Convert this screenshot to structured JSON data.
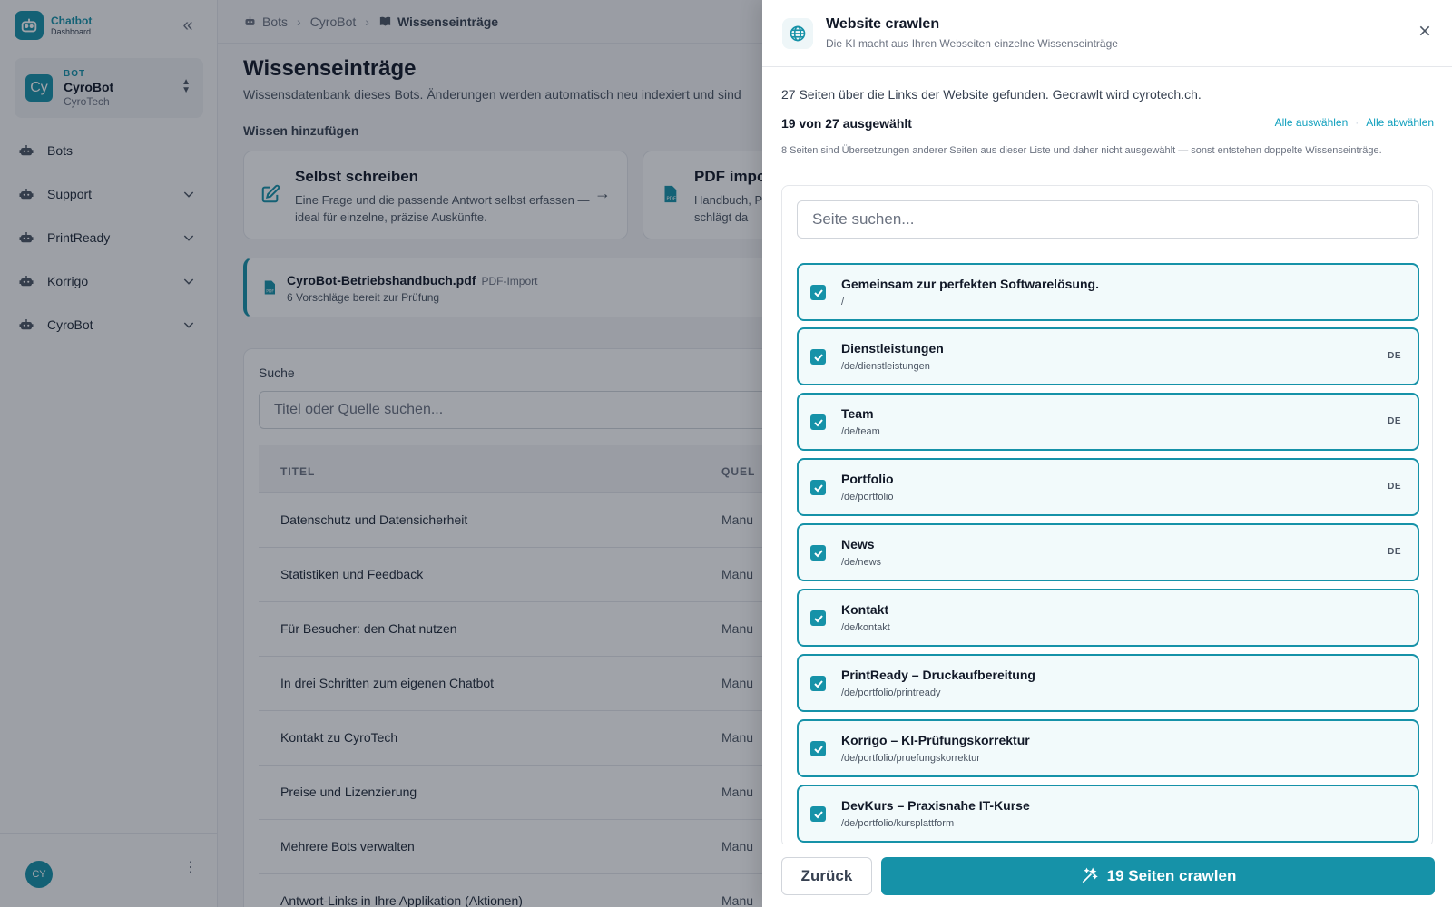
{
  "brand": {
    "name": "Chatbot",
    "sub": "Dashboard"
  },
  "bot_switcher": {
    "label": "BOT",
    "name": "CyroBot",
    "org": "CyroTech",
    "avatar": "Cy"
  },
  "sidebar": {
    "items": [
      {
        "label": "Bots",
        "icon": "robot-icon",
        "expandable": false
      },
      {
        "label": "Support",
        "icon": "robot-icon",
        "expandable": true
      },
      {
        "label": "PrintReady",
        "icon": "robot-icon",
        "expandable": true
      },
      {
        "label": "Korrigo",
        "icon": "robot-icon",
        "expandable": true
      },
      {
        "label": "CyroBot",
        "icon": "robot-icon",
        "expandable": true
      }
    ],
    "user_initials": "CY"
  },
  "breadcrumb": [
    "Bots",
    "CyroBot",
    "Wissenseinträge"
  ],
  "page": {
    "title": "Wissenseinträge",
    "subtitle": "Wissensdatenbank dieses Bots. Änderungen werden automatisch neu indexiert und sind",
    "section_label": "Wissen hinzufügen",
    "cards": [
      {
        "title": "Selbst schreiben",
        "desc": "Eine Frage und die passende Antwort selbst erfassen — ideal für einzelne, präzise Auskünfte."
      },
      {
        "title": "PDF impor",
        "desc": "Handbuch, P KI schlägt da"
      }
    ],
    "pdf_banner": {
      "file": "CyroBot-Betriebshandbuch.pdf",
      "tag": "PDF-Import",
      "status": "6 Vorschläge bereit zur Prüfung"
    },
    "search_label": "Suche",
    "search_placeholder": "Titel oder Quelle suchen...",
    "table": {
      "columns": [
        "TITEL",
        "QUEL"
      ],
      "rows": [
        {
          "title": "Datenschutz und Datensicherheit",
          "source": "Manu"
        },
        {
          "title": "Statistiken und Feedback",
          "source": "Manu"
        },
        {
          "title": "Für Besucher: den Chat nutzen",
          "source": "Manu"
        },
        {
          "title": "In drei Schritten zum eigenen Chatbot",
          "source": "Manu"
        },
        {
          "title": "Kontakt zu CyroTech",
          "source": "Manu"
        },
        {
          "title": "Preise und Lizenzierung",
          "source": "Manu"
        },
        {
          "title": "Mehrere Bots verwalten",
          "source": "Manu"
        },
        {
          "title": "Antwort-Links in Ihre Applikation (Aktionen)",
          "source": "Manu"
        }
      ]
    }
  },
  "drawer": {
    "title": "Website crawlen",
    "subtitle": "Die KI macht aus Ihren Webseiten einzelne Wissenseinträge",
    "info": "27 Seiten über die Links der Website gefunden. Gecrawlt wird cyrotech.ch.",
    "count": "19 von 27 ausgewählt",
    "select_all": "Alle auswählen",
    "deselect_all": "Alle abwählen",
    "note": "8 Seiten sind Übersetzungen anderer Seiten aus dieser Liste und daher nicht ausgewählt — sonst entstehen doppelte Wissenseinträge.",
    "search_placeholder": "Seite suchen...",
    "pages": [
      {
        "title": "Gemeinsam zur perfekten Softwarelösung.",
        "path": "/",
        "lang": "",
        "checked": true
      },
      {
        "title": "Dienstleistungen",
        "path": "/de/dienstleistungen",
        "lang": "DE",
        "checked": true
      },
      {
        "title": "Team",
        "path": "/de/team",
        "lang": "DE",
        "checked": true
      },
      {
        "title": "Portfolio",
        "path": "/de/portfolio",
        "lang": "DE",
        "checked": true
      },
      {
        "title": "News",
        "path": "/de/news",
        "lang": "DE",
        "checked": true
      },
      {
        "title": "Kontakt",
        "path": "/de/kontakt",
        "lang": "",
        "checked": true
      },
      {
        "title": "PrintReady – Druckaufbereitung",
        "path": "/de/portfolio/printready",
        "lang": "",
        "checked": true
      },
      {
        "title": "Korrigo – KI-Prüfungskorrektur",
        "path": "/de/portfolio/pruefungskorrektur",
        "lang": "",
        "checked": true
      },
      {
        "title": "DevKurs – Praxisnahe IT-Kurse",
        "path": "/de/portfolio/kursplattform",
        "lang": "",
        "checked": true
      }
    ],
    "back_label": "Zurück",
    "crawl_label": "19 Seiten crawlen"
  },
  "colors": {
    "accent": "#1692a8",
    "link": "#0f9fbd"
  }
}
